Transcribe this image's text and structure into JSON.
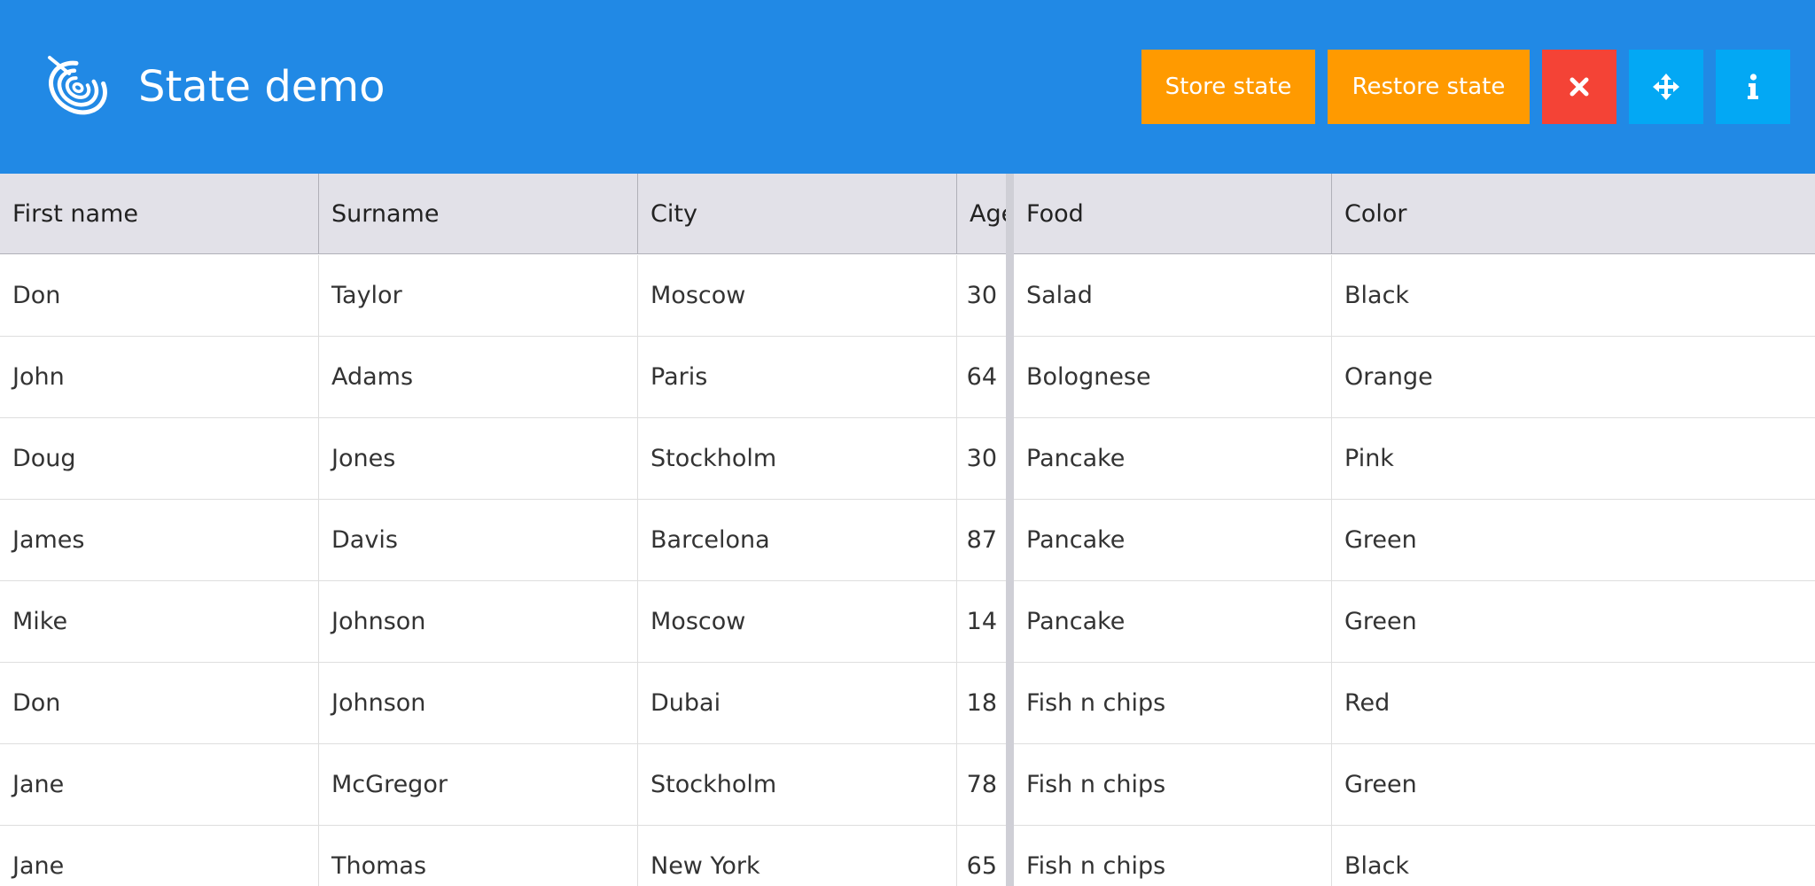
{
  "app": {
    "title": "State demo",
    "logo_icon": "spiral-logo-icon"
  },
  "toolbar": {
    "store_label": "Store state",
    "restore_label": "Restore state",
    "reset_icon": "close-icon",
    "move_icon": "move-arrows-icon",
    "info_icon": "info-icon"
  },
  "colors": {
    "header": "#2189e5",
    "store_restore": "#ff9a00",
    "reset": "#f44336",
    "icon_buttons": "#03a8f4",
    "grid_header": "#e2e1e8"
  },
  "grid": {
    "columns": [
      "First name",
      "Surname",
      "City",
      "Age",
      "Food",
      "Color"
    ],
    "rows": [
      [
        "Don",
        "Taylor",
        "Moscow",
        "30",
        "Salad",
        "Black"
      ],
      [
        "John",
        "Adams",
        "Paris",
        "64",
        "Bolognese",
        "Orange"
      ],
      [
        "Doug",
        "Jones",
        "Stockholm",
        "30",
        "Pancake",
        "Pink"
      ],
      [
        "James",
        "Davis",
        "Barcelona",
        "87",
        "Pancake",
        "Green"
      ],
      [
        "Mike",
        "Johnson",
        "Moscow",
        "14",
        "Pancake",
        "Green"
      ],
      [
        "Don",
        "Johnson",
        "Dubai",
        "18",
        "Fish n chips",
        "Red"
      ],
      [
        "Jane",
        "McGregor",
        "Stockholm",
        "78",
        "Fish n chips",
        "Green"
      ],
      [
        "Jane",
        "Thomas",
        "New York",
        "65",
        "Fish n chips",
        "Black"
      ]
    ]
  }
}
